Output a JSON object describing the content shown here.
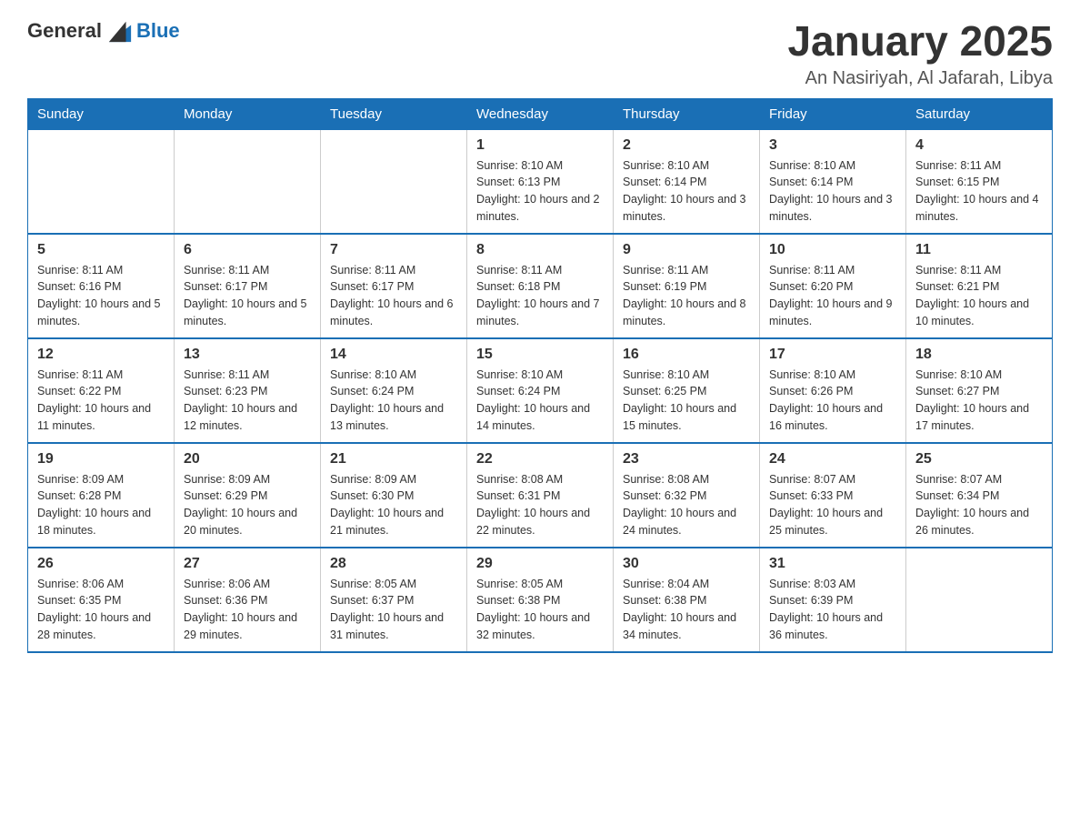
{
  "logo": {
    "general": "General",
    "blue": "Blue"
  },
  "header": {
    "month_year": "January 2025",
    "location": "An Nasiriyah, Al Jafarah, Libya"
  },
  "days_of_week": [
    "Sunday",
    "Monday",
    "Tuesday",
    "Wednesday",
    "Thursday",
    "Friday",
    "Saturday"
  ],
  "weeks": [
    [
      {
        "day": "",
        "info": ""
      },
      {
        "day": "",
        "info": ""
      },
      {
        "day": "",
        "info": ""
      },
      {
        "day": "1",
        "info": "Sunrise: 8:10 AM\nSunset: 6:13 PM\nDaylight: 10 hours and 2 minutes."
      },
      {
        "day": "2",
        "info": "Sunrise: 8:10 AM\nSunset: 6:14 PM\nDaylight: 10 hours and 3 minutes."
      },
      {
        "day": "3",
        "info": "Sunrise: 8:10 AM\nSunset: 6:14 PM\nDaylight: 10 hours and 3 minutes."
      },
      {
        "day": "4",
        "info": "Sunrise: 8:11 AM\nSunset: 6:15 PM\nDaylight: 10 hours and 4 minutes."
      }
    ],
    [
      {
        "day": "5",
        "info": "Sunrise: 8:11 AM\nSunset: 6:16 PM\nDaylight: 10 hours and 5 minutes."
      },
      {
        "day": "6",
        "info": "Sunrise: 8:11 AM\nSunset: 6:17 PM\nDaylight: 10 hours and 5 minutes."
      },
      {
        "day": "7",
        "info": "Sunrise: 8:11 AM\nSunset: 6:17 PM\nDaylight: 10 hours and 6 minutes."
      },
      {
        "day": "8",
        "info": "Sunrise: 8:11 AM\nSunset: 6:18 PM\nDaylight: 10 hours and 7 minutes."
      },
      {
        "day": "9",
        "info": "Sunrise: 8:11 AM\nSunset: 6:19 PM\nDaylight: 10 hours and 8 minutes."
      },
      {
        "day": "10",
        "info": "Sunrise: 8:11 AM\nSunset: 6:20 PM\nDaylight: 10 hours and 9 minutes."
      },
      {
        "day": "11",
        "info": "Sunrise: 8:11 AM\nSunset: 6:21 PM\nDaylight: 10 hours and 10 minutes."
      }
    ],
    [
      {
        "day": "12",
        "info": "Sunrise: 8:11 AM\nSunset: 6:22 PM\nDaylight: 10 hours and 11 minutes."
      },
      {
        "day": "13",
        "info": "Sunrise: 8:11 AM\nSunset: 6:23 PM\nDaylight: 10 hours and 12 minutes."
      },
      {
        "day": "14",
        "info": "Sunrise: 8:10 AM\nSunset: 6:24 PM\nDaylight: 10 hours and 13 minutes."
      },
      {
        "day": "15",
        "info": "Sunrise: 8:10 AM\nSunset: 6:24 PM\nDaylight: 10 hours and 14 minutes."
      },
      {
        "day": "16",
        "info": "Sunrise: 8:10 AM\nSunset: 6:25 PM\nDaylight: 10 hours and 15 minutes."
      },
      {
        "day": "17",
        "info": "Sunrise: 8:10 AM\nSunset: 6:26 PM\nDaylight: 10 hours and 16 minutes."
      },
      {
        "day": "18",
        "info": "Sunrise: 8:10 AM\nSunset: 6:27 PM\nDaylight: 10 hours and 17 minutes."
      }
    ],
    [
      {
        "day": "19",
        "info": "Sunrise: 8:09 AM\nSunset: 6:28 PM\nDaylight: 10 hours and 18 minutes."
      },
      {
        "day": "20",
        "info": "Sunrise: 8:09 AM\nSunset: 6:29 PM\nDaylight: 10 hours and 20 minutes."
      },
      {
        "day": "21",
        "info": "Sunrise: 8:09 AM\nSunset: 6:30 PM\nDaylight: 10 hours and 21 minutes."
      },
      {
        "day": "22",
        "info": "Sunrise: 8:08 AM\nSunset: 6:31 PM\nDaylight: 10 hours and 22 minutes."
      },
      {
        "day": "23",
        "info": "Sunrise: 8:08 AM\nSunset: 6:32 PM\nDaylight: 10 hours and 24 minutes."
      },
      {
        "day": "24",
        "info": "Sunrise: 8:07 AM\nSunset: 6:33 PM\nDaylight: 10 hours and 25 minutes."
      },
      {
        "day": "25",
        "info": "Sunrise: 8:07 AM\nSunset: 6:34 PM\nDaylight: 10 hours and 26 minutes."
      }
    ],
    [
      {
        "day": "26",
        "info": "Sunrise: 8:06 AM\nSunset: 6:35 PM\nDaylight: 10 hours and 28 minutes."
      },
      {
        "day": "27",
        "info": "Sunrise: 8:06 AM\nSunset: 6:36 PM\nDaylight: 10 hours and 29 minutes."
      },
      {
        "day": "28",
        "info": "Sunrise: 8:05 AM\nSunset: 6:37 PM\nDaylight: 10 hours and 31 minutes."
      },
      {
        "day": "29",
        "info": "Sunrise: 8:05 AM\nSunset: 6:38 PM\nDaylight: 10 hours and 32 minutes."
      },
      {
        "day": "30",
        "info": "Sunrise: 8:04 AM\nSunset: 6:38 PM\nDaylight: 10 hours and 34 minutes."
      },
      {
        "day": "31",
        "info": "Sunrise: 8:03 AM\nSunset: 6:39 PM\nDaylight: 10 hours and 36 minutes."
      },
      {
        "day": "",
        "info": ""
      }
    ]
  ]
}
